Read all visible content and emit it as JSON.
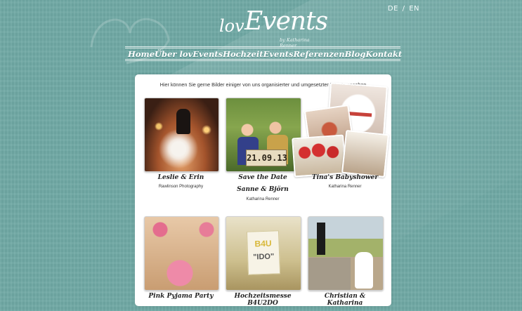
{
  "lang": {
    "de": "DE",
    "sep": "/",
    "en": "EN"
  },
  "logo": {
    "love": "lov",
    "events": "Events",
    "byline": "by Katharina Renner"
  },
  "nav": [
    "Home",
    "Über lovEvents",
    "Hochzeit",
    "Events",
    "Referenzen",
    "Blog",
    "Kontakt"
  ],
  "nav_active": "Referenzen",
  "intro": "Hier können Sie gerne Bilder einiger von uns organisierter und umgesetzter Events ansehen",
  "items": [
    {
      "title": "Leslie & Erin",
      "subtitle": "Rawlinson Photography"
    },
    {
      "title": "Save the Date",
      "title2": "Sanne & Björn",
      "subtitle": "Katharina Renner",
      "sign": "21.09.13"
    },
    {
      "title": "Tina's Babyshower",
      "subtitle": "Katharina Renner"
    },
    {
      "title": "Pink Pyjama Party"
    },
    {
      "title": "Hochzeitsmesse B4U2DO",
      "tag_line1": "B4U",
      "tag_line2": "\"IDO\""
    },
    {
      "title": "Christian & Katharina"
    }
  ]
}
